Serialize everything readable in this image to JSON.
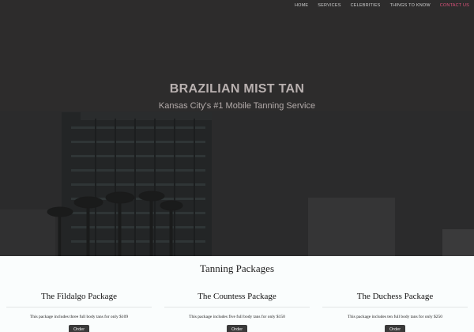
{
  "nav": {
    "items": [
      {
        "label": "HOME"
      },
      {
        "label": "SERVICES"
      },
      {
        "label": "CELEBRITIES"
      },
      {
        "label": "THINGS TO KNOW"
      },
      {
        "label": "CONTACT US"
      }
    ],
    "active_index": 4,
    "active_color": "#e0527d"
  },
  "hero": {
    "title": "BRAZILIAN MIST TAN",
    "subtitle": "Kansas City's #1 Mobile Tanning Service"
  },
  "packages": {
    "heading": "Tanning Packages",
    "items": [
      {
        "name": "The Fildalgo Package",
        "description": "This package includes three full body tans for only $109",
        "button": "Order"
      },
      {
        "name": "The Countess Package",
        "description": "This package includes five full body tans for only $150",
        "button": "Order"
      },
      {
        "name": "The Duchess Package",
        "description": "This package includes ten full body tans for only $250",
        "button": "Order"
      }
    ]
  }
}
